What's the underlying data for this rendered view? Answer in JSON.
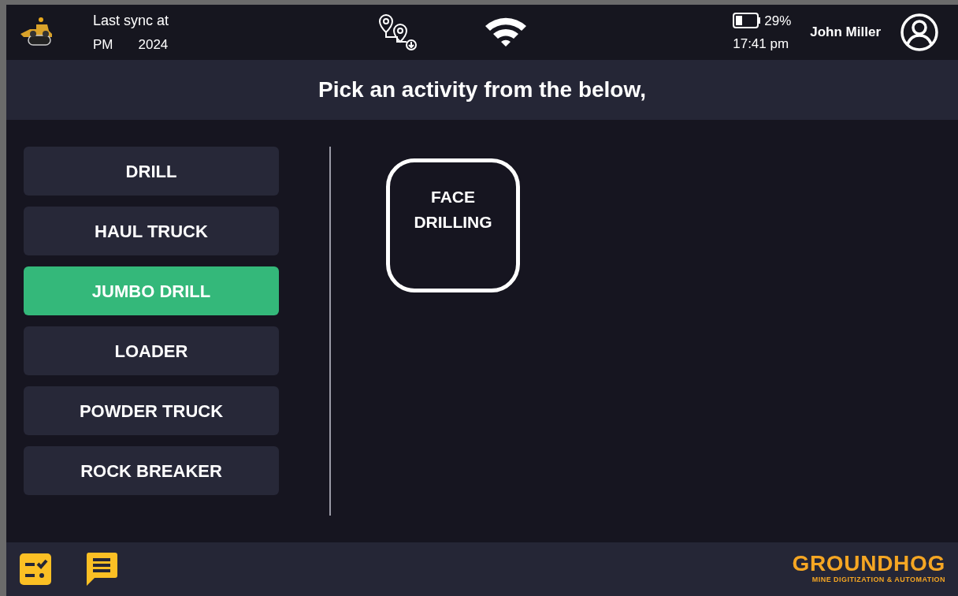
{
  "header": {
    "sync_label": "Last sync at",
    "sync_period": "PM",
    "sync_year": "2024",
    "battery": "29%",
    "time": "17:41 pm",
    "user": "John Miller"
  },
  "title": "Pick an activity from the below,",
  "equipment": [
    {
      "label": "DRILL",
      "selected": false
    },
    {
      "label": "HAUL TRUCK",
      "selected": false
    },
    {
      "label": "JUMBO DRILL",
      "selected": true
    },
    {
      "label": "LOADER",
      "selected": false
    },
    {
      "label": "POWDER TRUCK",
      "selected": false
    },
    {
      "label": "ROCK BREAKER",
      "selected": false
    }
  ],
  "activities": [
    {
      "label": "FACE DRILLING"
    }
  ],
  "footer": {
    "brand": "GROUNDHOG",
    "tagline": "MINE DIGITIZATION & AUTOMATION"
  }
}
